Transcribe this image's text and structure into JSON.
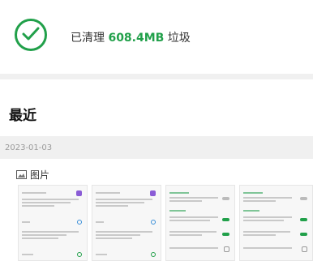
{
  "cleanup": {
    "prefix": "已清理 ",
    "amount": "608.4MB",
    "suffix": " 垃圾"
  },
  "recent": {
    "title": "最近"
  },
  "group": {
    "date": "2023-01-03",
    "category": "图片"
  },
  "colors": {
    "accent": "#21a04a"
  },
  "icons": {
    "done": "check-circle-icon",
    "category": "image-icon"
  }
}
